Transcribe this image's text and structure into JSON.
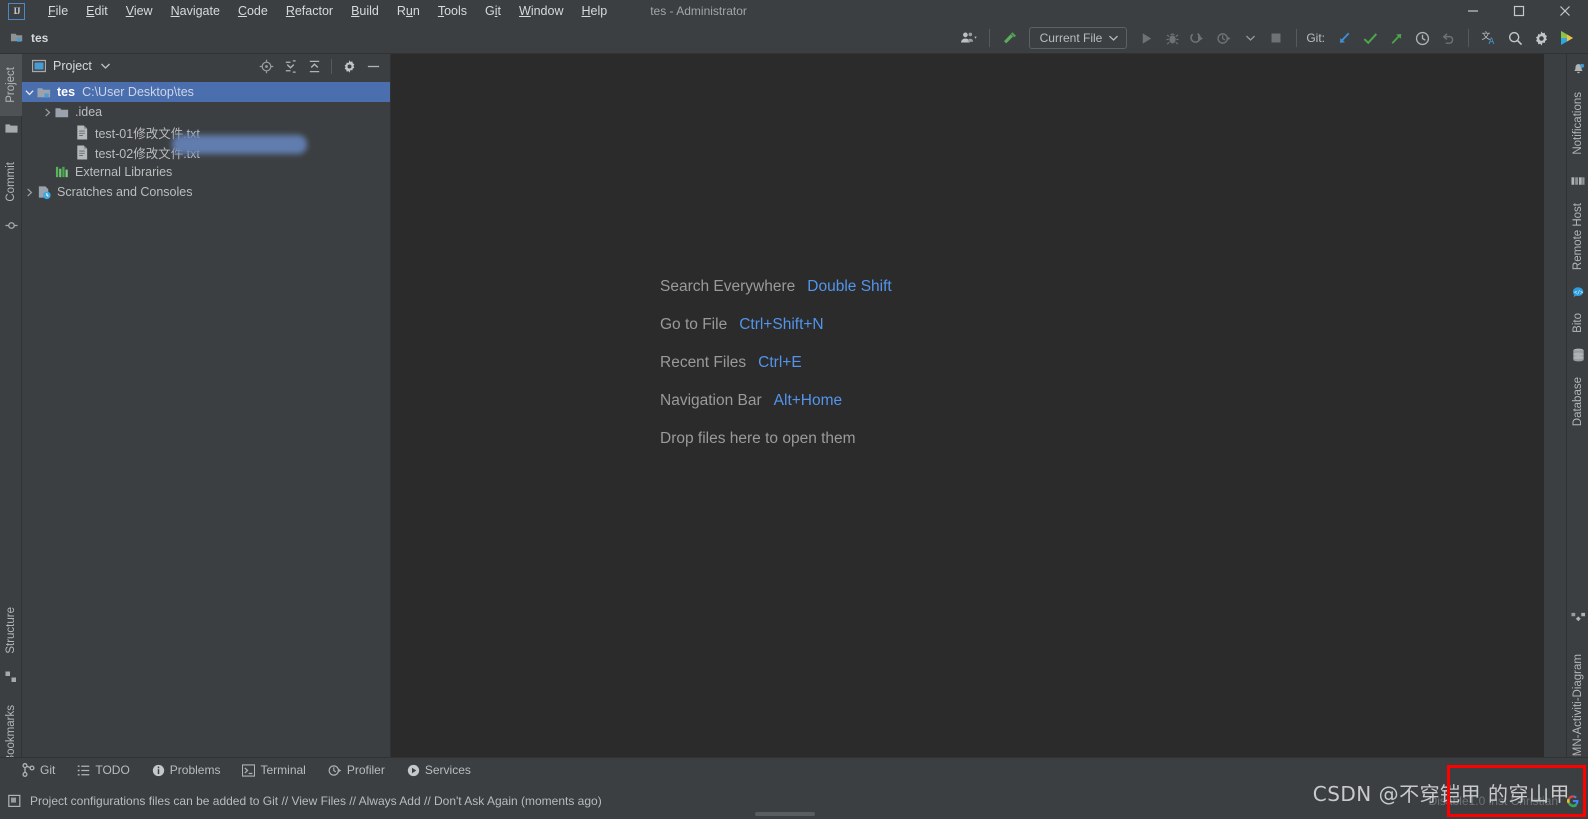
{
  "window": {
    "title": "tes - Administrator",
    "logo_text": "IJ",
    "controls": [
      "minimize",
      "maximize",
      "close"
    ]
  },
  "menu": [
    {
      "label": "File",
      "mnemonic": "F"
    },
    {
      "label": "Edit",
      "mnemonic": "E"
    },
    {
      "label": "View",
      "mnemonic": "V"
    },
    {
      "label": "Navigate",
      "mnemonic": "N"
    },
    {
      "label": "Code",
      "mnemonic": "C"
    },
    {
      "label": "Refactor",
      "mnemonic": "R"
    },
    {
      "label": "Build",
      "mnemonic": "B"
    },
    {
      "label": "Run",
      "mnemonic": "u"
    },
    {
      "label": "Tools",
      "mnemonic": "T"
    },
    {
      "label": "Git",
      "mnemonic": "i"
    },
    {
      "label": "Window",
      "mnemonic": "W"
    },
    {
      "label": "Help",
      "mnemonic": "H"
    }
  ],
  "navbar": {
    "breadcrumb": "tes",
    "breadcrumb_icon": "project-folder-icon",
    "run_config": "Current File",
    "git_label": "Git:",
    "buttons": {
      "user_icon": "user-avatar-icon",
      "search_everywhere_icon": "search-icon",
      "settings_icon": "gear-icon",
      "run_icon": "run-triangle-icon",
      "debug_icon": "debug-bug-icon",
      "run_coverage_icon": "run-with-coverage-icon",
      "profile_icon": "profiler-icon",
      "stop_icon": "stop-square-icon",
      "git_update_icon": "git-update-arrow-icon",
      "git_commit_icon": "git-commit-check-icon",
      "git_push_icon": "git-push-arrow-icon",
      "git_history_icon": "history-clock-icon",
      "git_rollback_icon": "rollback-undo-icon",
      "translate_icon": "translate-icon",
      "bito_icon": "bito-logo-icon"
    }
  },
  "left_strip": {
    "top_items": [
      {
        "label": "Project",
        "active": true,
        "icon": "project-icon"
      },
      {
        "label": "",
        "active": false,
        "icon": "folder-icon"
      },
      {
        "label": "Commit",
        "active": false,
        "icon": "commit-icon"
      }
    ],
    "bottom_items": [
      {
        "label": "Structure",
        "icon": "structure-icon"
      },
      {
        "label": "Bookmarks",
        "icon": "bookmark-icon"
      }
    ]
  },
  "right_strip": {
    "top_items": [
      {
        "label": "Notifications",
        "icon": "bell-icon",
        "badge": true
      },
      {
        "label": "Remote Host",
        "icon": "remote-host-icon"
      },
      {
        "label": "Bito",
        "icon": "bito-chat-icon"
      },
      {
        "label": "Database",
        "icon": "database-icon"
      }
    ],
    "bottom_items": [
      {
        "label": "BPMN-Activiti-Diagram",
        "icon": "bpmn-diagram-icon"
      }
    ]
  },
  "project_panel": {
    "title": "Project",
    "dropdown_icon": "chevron-down-icon",
    "tools": [
      {
        "name": "select-opened-file-icon"
      },
      {
        "name": "expand-all-icon"
      },
      {
        "name": "collapse-all-icon"
      },
      {
        "name": "gear-icon"
      },
      {
        "name": "hide-icon"
      }
    ],
    "tree": [
      {
        "name": "tes",
        "path": "C:\\User                 Desktop\\tes",
        "icon": "module-folder-icon",
        "arrow": "expanded",
        "indent": 0,
        "selected": true,
        "bold": true
      },
      {
        "name": ".idea",
        "path": "",
        "icon": "folder-icon",
        "arrow": "collapsed",
        "indent": 1,
        "selected": false,
        "bold": false
      },
      {
        "name": "test-01修改文件.txt",
        "path": "",
        "icon": "text-file-icon",
        "arrow": "none",
        "indent": 2,
        "selected": false,
        "bold": false
      },
      {
        "name": "test-02修改文件.txt",
        "path": "",
        "icon": "text-file-icon",
        "arrow": "none",
        "indent": 2,
        "selected": false,
        "bold": false
      },
      {
        "name": "External Libraries",
        "path": "",
        "icon": "libraries-icon",
        "arrow": "none",
        "indent": 1,
        "selected": false,
        "bold": false
      },
      {
        "name": "Scratches and Consoles",
        "path": "",
        "icon": "scratches-icon",
        "arrow": "collapsed",
        "indent": 0,
        "selected": false,
        "bold": false
      }
    ]
  },
  "editor": {
    "hints": [
      {
        "text": "Search Everywhere",
        "key": "Double Shift"
      },
      {
        "text": "Go to File",
        "key": "Ctrl+Shift+N"
      },
      {
        "text": "Recent Files",
        "key": "Ctrl+E"
      },
      {
        "text": "Navigation Bar",
        "key": "Alt+Home"
      },
      {
        "text": "Drop files here to open them",
        "key": ""
      }
    ]
  },
  "bottom_bar": [
    {
      "label": "Git",
      "icon": "git-branch-icon"
    },
    {
      "label": "TODO",
      "icon": "todo-list-icon"
    },
    {
      "label": "Problems",
      "icon": "problems-icon"
    },
    {
      "label": "Terminal",
      "icon": "terminal-icon"
    },
    {
      "label": "Profiler",
      "icon": "profiler-icon"
    },
    {
      "label": "Services",
      "icon": "services-icon"
    }
  ],
  "status_bar": {
    "icon": "event-log-icon",
    "message": "Project configurations files can be added to Git // View Files // Always Add // Don't Ask Again (moments ago)",
    "right_faint": "Disable1.0 inst Christian"
  },
  "watermark": "CSDN @不穿铠甲 的穿山甲",
  "annotation": {
    "type": "red-rectangle",
    "color": "#ff0000"
  },
  "colors": {
    "chrome": "#3c3f41",
    "editor_bg": "#2b2b2b",
    "selection": "#4b6eaf",
    "accent_blue": "#5394ec",
    "text": "#bbbdbf"
  }
}
